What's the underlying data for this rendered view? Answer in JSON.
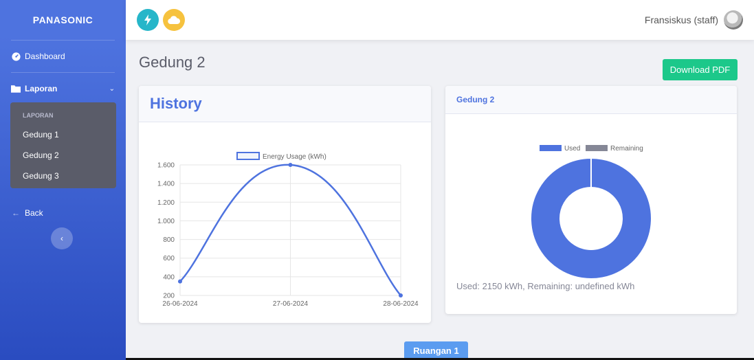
{
  "sidebar": {
    "brand": "PANASONIC",
    "dashboard_label": "Dashboard",
    "laporan_label": "Laporan",
    "collapse_header": "LAPORAN",
    "items": [
      {
        "label": "Gedung 1"
      },
      {
        "label": "Gedung 2"
      },
      {
        "label": "Gedung 3"
      }
    ],
    "back_label": "Back"
  },
  "topbar": {
    "user_label": "Fransiskus (staff)"
  },
  "page": {
    "title": "Gedung 2",
    "download_label": "Download PDF",
    "ruangan_label": "Ruangan 1"
  },
  "history_card": {
    "title": "History"
  },
  "donut_card": {
    "title": "Gedung 2",
    "caption": "Used: 2150 kWh, Remaining: undefined kWh"
  },
  "colors": {
    "primary": "#4e73df",
    "success": "#1cc88a",
    "remaining": "#858796"
  },
  "chart_data": [
    {
      "type": "line",
      "x": [
        "26-06-2024",
        "27-06-2024",
        "28-06-2024"
      ],
      "series": [
        {
          "name": "Energy Usage (kWh)",
          "values": [
            350,
            1600,
            200
          ]
        }
      ],
      "ylim": [
        200,
        1600
      ],
      "yticks": [
        "1.600",
        "1.400",
        "1.200",
        "1.000",
        "800",
        "600",
        "400",
        "200"
      ],
      "yvals": [
        1600,
        1400,
        1200,
        1000,
        800,
        600,
        400,
        200
      ],
      "grid": true,
      "legend": "top"
    },
    {
      "type": "pie",
      "categories": [
        "Used",
        "Remaining"
      ],
      "values": [
        2150,
        0
      ],
      "legend": "top"
    }
  ]
}
